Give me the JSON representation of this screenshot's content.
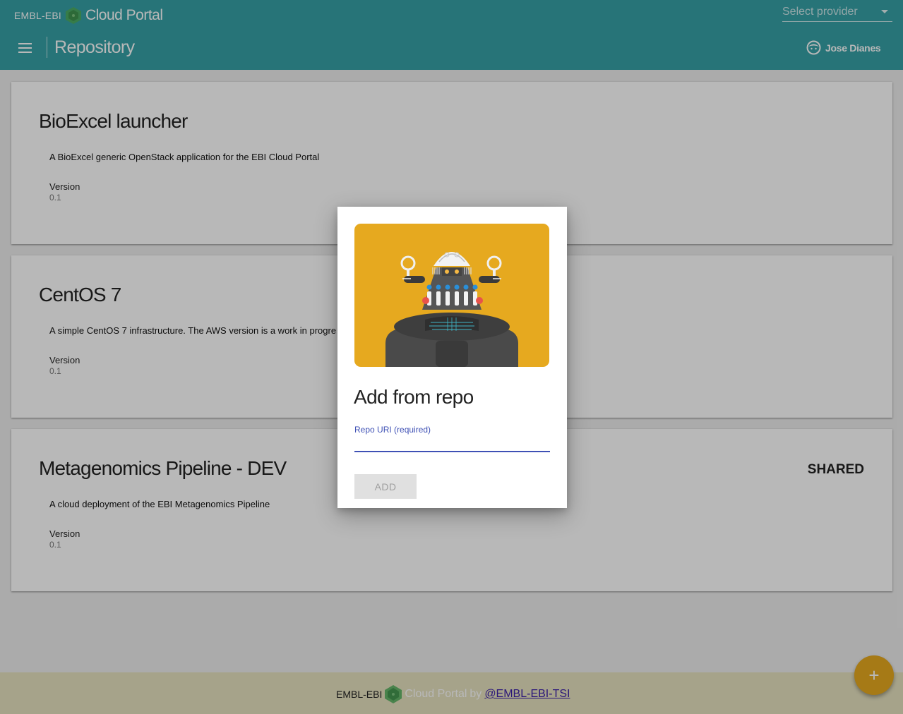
{
  "header": {
    "brand_ebi": "EMBL-EBI",
    "brand_name": "Cloud Portal",
    "provider_placeholder": "Select provider",
    "page_title": "Repository",
    "user_name": "Jose Dianes",
    "bg_color": "#37a1a7"
  },
  "cards": [
    {
      "title": "BioExcel launcher",
      "description": "A BioExcel generic OpenStack application for the EBI Cloud Portal",
      "version_label": "Version",
      "version": "0.1"
    },
    {
      "title": "CentOS 7",
      "description": "A simple CentOS 7 infrastructure. The AWS version is a work in progre",
      "version_label": "Version",
      "version": "0.1"
    },
    {
      "title": "Metagenomics Pipeline - DEV",
      "description": "A cloud deployment of the EBI Metagenomics Pipeline",
      "version_label": "Version",
      "version": "0.1",
      "badge": "SHARED"
    }
  ],
  "dialog": {
    "title": "Add from repo",
    "field_label": "Repo URI (required)",
    "field_value": "",
    "add_label": "ADD",
    "illustration_bg": "#e6a91f"
  },
  "footer": {
    "brand_ebi": "EMBL-EBI",
    "brand_name": "Cloud Portal",
    "by_text": "by",
    "link_text": "@EMBL-EBI-TSI"
  },
  "fab": {
    "icon": "plus-icon",
    "label": "+",
    "color": "#e6a91f"
  }
}
